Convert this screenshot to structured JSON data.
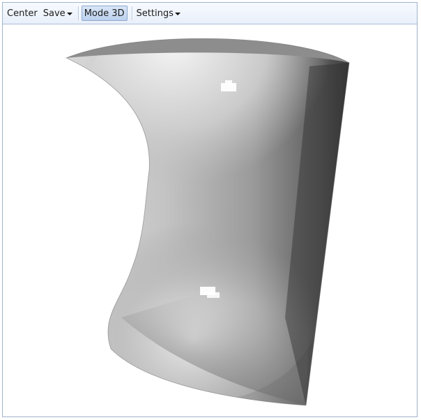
{
  "toolbar": {
    "center_label": "Center",
    "save_label": "Save",
    "mode_label": "Mode 3D",
    "settings_label": "Settings"
  },
  "viewport": {
    "surface_colors": {
      "light": "#f7f7f7",
      "mid": "#a9a9a9",
      "dark": "#2d2d2d"
    }
  }
}
